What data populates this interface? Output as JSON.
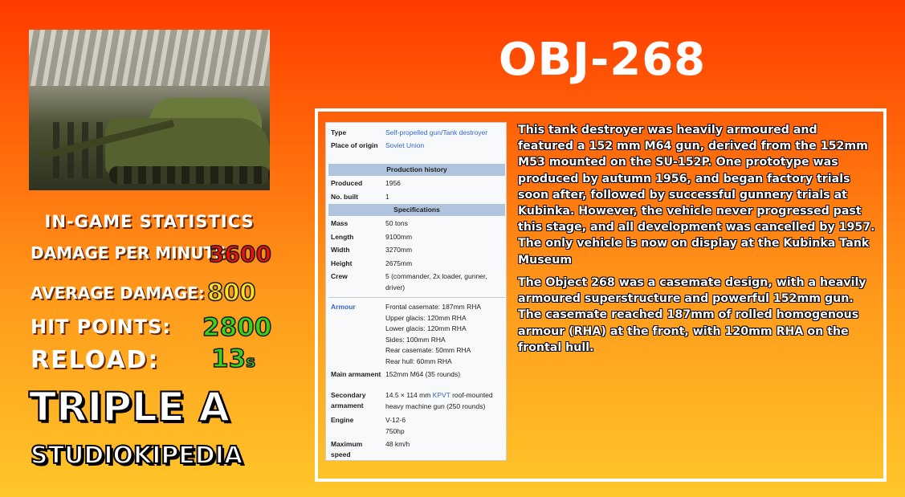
{
  "title": "OBJ-268",
  "stats": {
    "heading": "IN-GAME STATISTICS",
    "dpm_label": "DAMAGE PER MINUTE:",
    "dpm_value": "3600",
    "avg_label": "AVERAGE DAMAGE:",
    "avg_value": "800",
    "hp_label": "HIT POINTS:",
    "hp_value": "2800",
    "reload_label": "RELOAD:",
    "reload_value": "13",
    "reload_unit": "s"
  },
  "branding": {
    "line1": "TRIPLE A",
    "line2": "STUDIOKIPEDIA"
  },
  "infobox": {
    "type_key": "Type",
    "type_val": "Self-propelled gun/Tank destroyer",
    "origin_key": "Place of origin",
    "origin_val": "Soviet Union",
    "production_heading": "Production history",
    "produced_key": "Produced",
    "produced_val": "1956",
    "built_key": "No. built",
    "built_val": "1",
    "specs_heading": "Specifications",
    "mass_key": "Mass",
    "mass_val": "50 tons",
    "length_key": "Length",
    "length_val": "9100mm",
    "width_key": "Width",
    "width_val": "3270mm",
    "height_key": "Height",
    "height_val": "2675mm",
    "crew_key": "Crew",
    "crew_val": "5 (commander, 2x loader, gunner, driver)",
    "armour_key": "Armour",
    "armour_lines": [
      "Frontal casemate: 187mm RHA",
      "Upper glacis: 120mm RHA",
      "Lower glacis: 120mm RHA",
      "Sides: 100mm RHA",
      "Rear casemate: 50mm RHA",
      "Rear hull: 60mm RHA"
    ],
    "main_key": "Main armament",
    "main_val": "152mm M64 (35 rounds)",
    "secondary_key": "Secondary armament",
    "secondary_pre": "14.5 × 114 mm ",
    "secondary_link": "KPVT",
    "secondary_post": " roof-mounted heavy machine gun (250 rounds)",
    "engine_key": "Engine",
    "engine_val1": "V-12-6",
    "engine_val2": "750hp",
    "speed_key": "Maximum speed",
    "speed_val": "48 km/h"
  },
  "description": {
    "paragraph1": "This tank destroyer was heavily armoured and featured a 152 mm M64 gun, derived from the 152mm M53 mounted on the SU-152P. One prototype was produced by autumn 1956, and began factory trials soon after, followed by successful gunnery trials at Kubinka. However, the vehicle never progressed past this stage, and all development was cancelled by 1957. The only vehicle is now on display at the Kubinka Tank Museum",
    "paragraph2": "The Object 268 was a casemate design, with a heavily armoured superstructure and powerful 152mm gun. The casemate reached 187mm of rolled homogenous armour (RHA) at the front, with 120mm RHA on the frontal hull."
  },
  "colors": {
    "dpm": "#e8140c",
    "avg": "#ffe01a",
    "hp": "#3ad11a",
    "reload": "#3ad11a"
  }
}
